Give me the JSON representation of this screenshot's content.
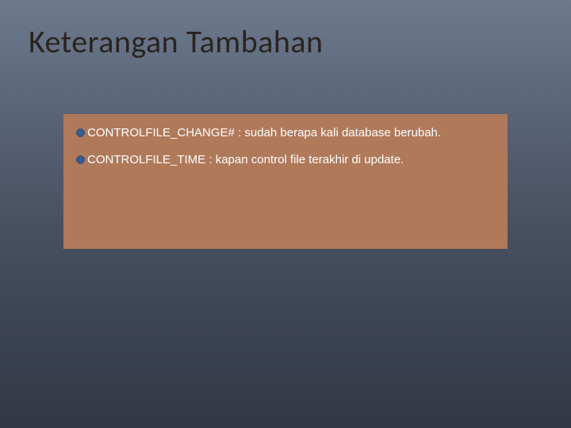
{
  "slide": {
    "title": "Keterangan Tambahan"
  },
  "bullets": [
    {
      "text": "CONTROLFILE_CHANGE# : sudah berapa kali database berubah."
    },
    {
      "text": "CONTROLFILE_TIME : kapan control file terakhir di update."
    }
  ],
  "colors": {
    "box_bg": "#b0795a",
    "bullet_fill": "#3a5b8c",
    "bullet_stroke": "#2a3f5f",
    "title": "#2a2420"
  }
}
